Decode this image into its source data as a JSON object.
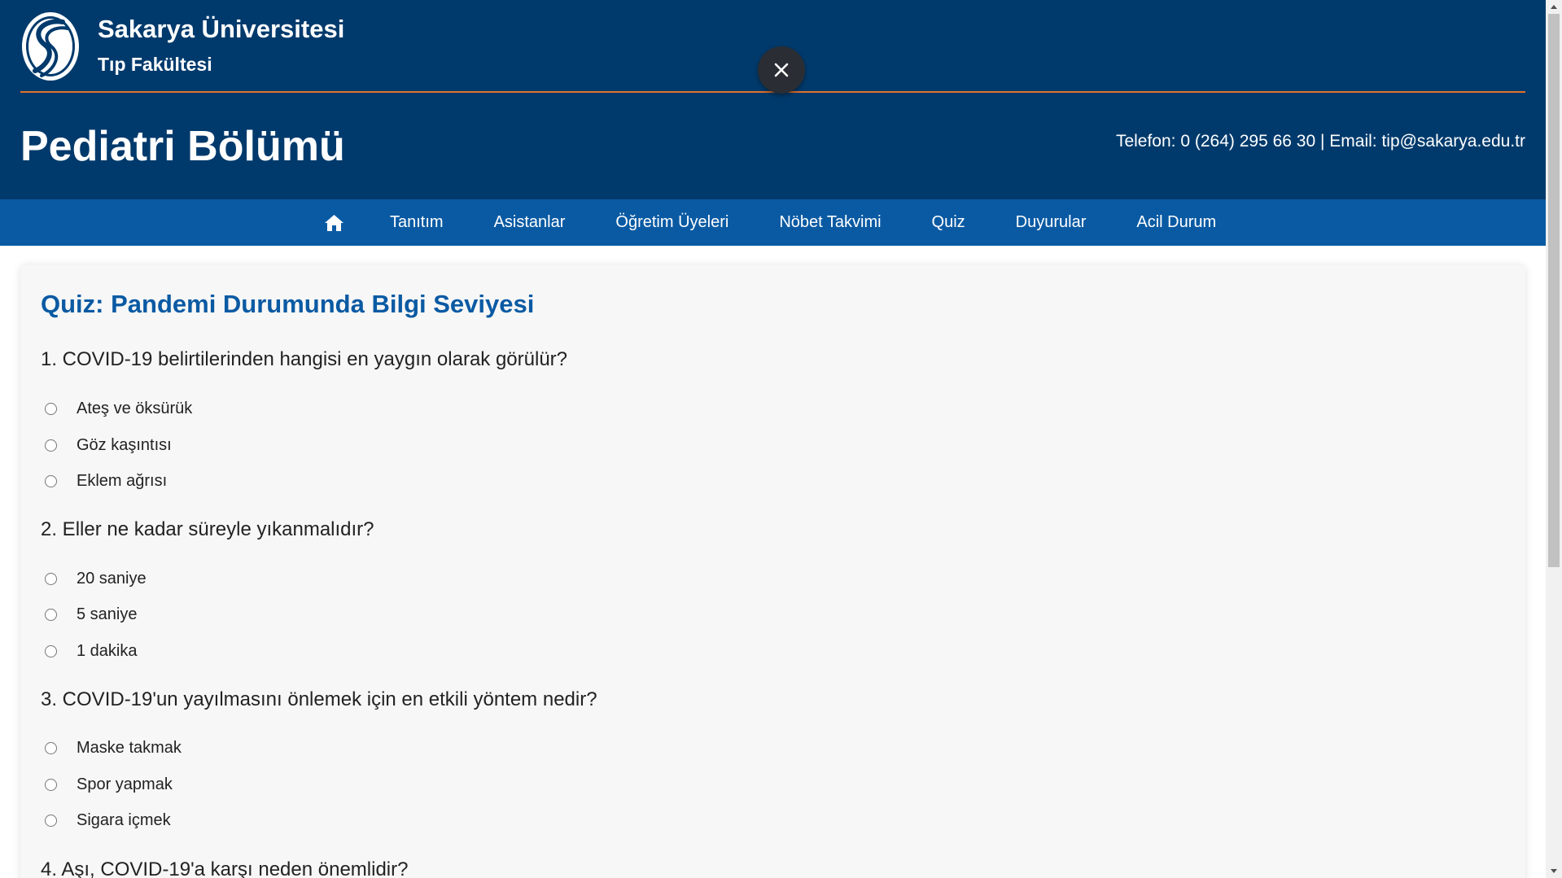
{
  "header": {
    "university": "Sakarya Üniversitesi",
    "faculty": "Tıp Fakültesi",
    "department": "Pediatri Bölümü",
    "contact": "Telefon: 0 (264) 295 66 30 | Email: tip@sakarya.edu.tr",
    "close_icon": "close-icon",
    "logo_icon": "university-logo"
  },
  "nav": {
    "home_icon": "home-icon",
    "items": [
      "Tanıtım",
      "Asistanlar",
      "Öğretim Üyeleri",
      "Nöbet Takvimi",
      "Quiz",
      "Duyurular",
      "Acil Durum"
    ]
  },
  "quiz": {
    "title": "Quiz: Pandemi Durumunda Bilgi Seviyesi",
    "questions": [
      {
        "text": "1. COVID-19 belirtilerinden hangisi en yaygın olarak görülür?",
        "options": [
          "Ateş ve öksürük",
          "Göz kaşıntısı",
          "Eklem ağrısı"
        ]
      },
      {
        "text": "2. Eller ne kadar süreyle yıkanmalıdır?",
        "options": [
          "20 saniye",
          "5 saniye",
          "1 dakika"
        ]
      },
      {
        "text": "3. COVID-19'un yayılmasını önlemek için en etkili yöntem nedir?",
        "options": [
          "Maske takmak",
          "Spor yapmak",
          "Sigara içmek"
        ]
      },
      {
        "text": "4. Aşı, COVID-19'a karşı neden önemlidir?",
        "options": []
      }
    ]
  },
  "colors": {
    "header_bg": "#003a6c",
    "nav_bg": "#0a5aa3",
    "accent_line": "#e0712a",
    "title_blue": "#0a5aa3"
  }
}
